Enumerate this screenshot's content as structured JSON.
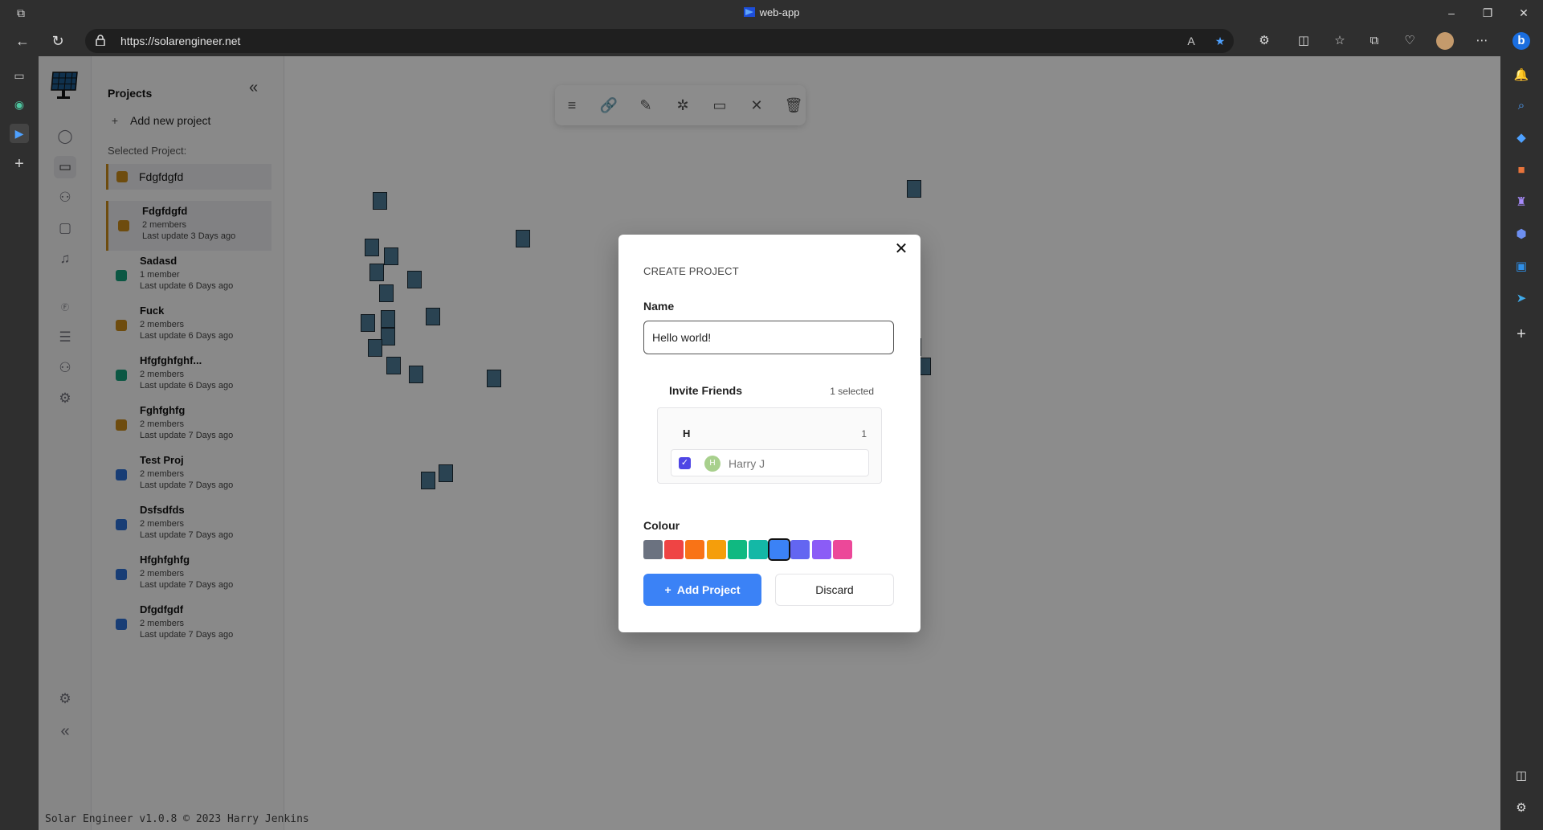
{
  "browser": {
    "tab_title": "web-app",
    "url": "https://solarengineer.net",
    "toolbar_icons": [
      "read-aloud-icon",
      "favorite-star-icon",
      "extensions-icon",
      "split-screen-icon",
      "favorites-icon",
      "collections-icon",
      "performance-icon",
      "profile-icon",
      "more-icon"
    ],
    "right_sidebar_icons": [
      "notifications-icon",
      "search-icon",
      "shopping-icon",
      "tools-icon",
      "games-icon",
      "office-icon",
      "outlook-icon",
      "telegram-icon",
      "add-icon"
    ]
  },
  "sidebar": {
    "header": "Projects",
    "add_new_label": "Add new project",
    "selected_label": "Selected Project:",
    "selected_project": {
      "name": "Fdgfdgfd",
      "color": "#c98a1b"
    },
    "projects": [
      {
        "name": "Fdgfdgfd",
        "members": "2 members",
        "last_update": "Last update 3 Days ago",
        "color": "#c98a1b",
        "active": true
      },
      {
        "name": "Sadasd",
        "members": "1 member",
        "last_update": "Last update 6 Days ago",
        "color": "#149e7a"
      },
      {
        "name": "Fuck",
        "members": "2 members",
        "last_update": "Last update 6 Days ago",
        "color": "#c98a1b"
      },
      {
        "name": "Hfgfghfghf...",
        "members": "2 members",
        "last_update": "Last update 6 Days ago",
        "color": "#149e7a"
      },
      {
        "name": "Fghfghfg",
        "members": "2 members",
        "last_update": "Last update 7 Days ago",
        "color": "#c98a1b"
      },
      {
        "name": "Test Proj",
        "members": "2 members",
        "last_update": "Last update 7 Days ago",
        "color": "#2d6fd6"
      },
      {
        "name": "Dsfsdfds",
        "members": "2 members",
        "last_update": "Last update 7 Days ago",
        "color": "#2d6fd6"
      },
      {
        "name": "Hfghfghfg",
        "members": "2 members",
        "last_update": "Last update 7 Days ago",
        "color": "#2d6fd6"
      },
      {
        "name": "Dfgdfgdf",
        "members": "2 members",
        "last_update": "Last update 7 Days ago",
        "color": "#2d6fd6"
      }
    ]
  },
  "footer": "Solar Engineer v1.0.8 © 2023 Harry Jenkins",
  "modal": {
    "title": "CREATE PROJECT",
    "name_label": "Name",
    "name_value": "Hello world!",
    "invite_title": "Invite Friends",
    "invite_count": "1 selected",
    "group_letter": "H",
    "group_count": "1",
    "friend": {
      "initial": "H",
      "name": "Harry J",
      "checked": true
    },
    "colour_label": "Colour",
    "colours": [
      "#6b7280",
      "#ef4444",
      "#f97316",
      "#f59e0b",
      "#10b981",
      "#14b8a6",
      "#3b82f6",
      "#6366f1",
      "#8b5cf6",
      "#ec4899"
    ],
    "selected_colour_index": 6,
    "add_button": "Add Project",
    "discard_button": "Discard"
  }
}
